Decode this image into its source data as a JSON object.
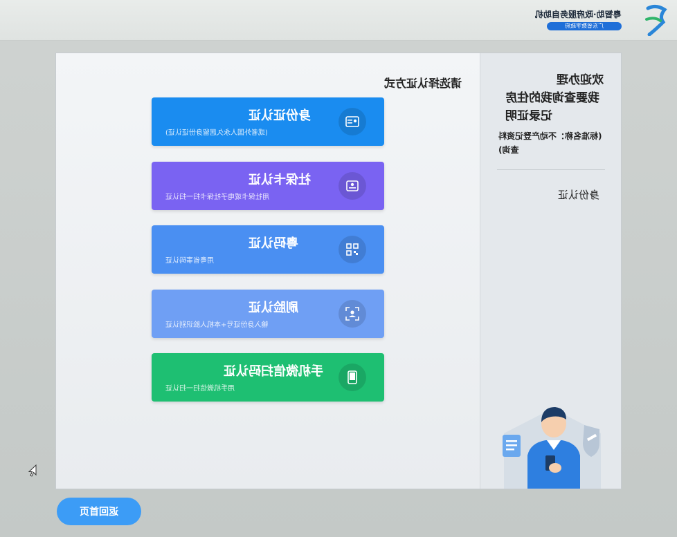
{
  "header": {
    "brand_name": "粤智助·政府服务自助机",
    "brand_tagline": "广东省数字政府"
  },
  "main": {
    "prompt": "请选择认证方式",
    "options": [
      {
        "title": "身份证认证",
        "subtitle": "(或者外国人永久居留身份证认证)",
        "icon": "id-card-icon",
        "color": "#1a8cf0"
      },
      {
        "title": "社保卡认证",
        "subtitle": "用社保卡或电子社保卡扫一扫认证",
        "icon": "social-security-card-icon",
        "color": "#7a63f2"
      },
      {
        "title": "粤码认证",
        "subtitle": "用粤省事码认证",
        "icon": "qr-code-icon",
        "color": "#4a8ff2"
      },
      {
        "title": "刷脸认证",
        "subtitle": "输入身份证号+本机人脸识别认证",
        "icon": "face-scan-icon",
        "color": "#6f9ff4"
      },
      {
        "title": "手机微信扫码认证",
        "subtitle": "用手机微信扫一扫认证",
        "icon": "phone-icon",
        "color": "#1ebf72"
      }
    ]
  },
  "sidebar": {
    "welcome": "欢迎办理",
    "service": "我要查询我的住房记录证明",
    "standard_name": "(标准名称：不动产登记资料查询)",
    "auth_label": "身份认证"
  },
  "footer": {
    "home_button": "返回首页"
  }
}
